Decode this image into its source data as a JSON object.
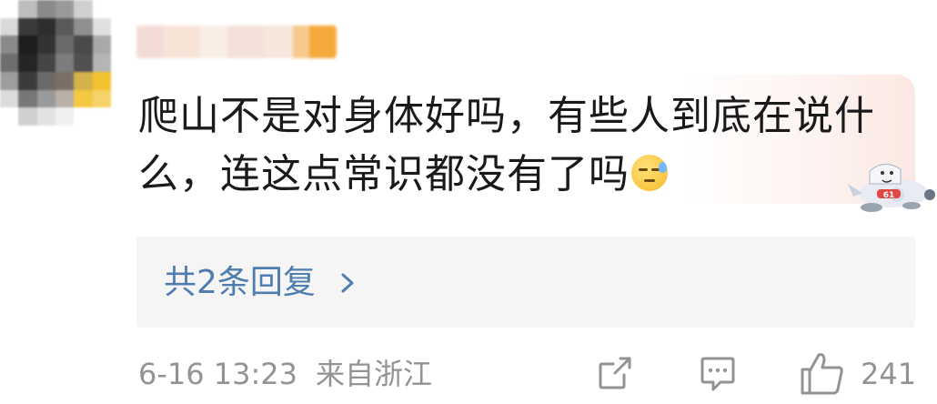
{
  "comment": {
    "text": "爬山不是对身体好吗，有些人到底在说什么，连这点常识都没有了吗",
    "emoji": "sweat-emoji"
  },
  "replies": {
    "label": "共2条回复"
  },
  "meta": {
    "time": "6-16 13:23",
    "location": "来自浙江"
  },
  "actions": {
    "like_count": "241",
    "icons": [
      "share-icon",
      "comment-icon",
      "like-icon"
    ]
  },
  "colors": {
    "link": "#507daf",
    "meta_gray": "#939393",
    "reply_bg": "#f5f5f5",
    "text": "#1a1a1a"
  }
}
